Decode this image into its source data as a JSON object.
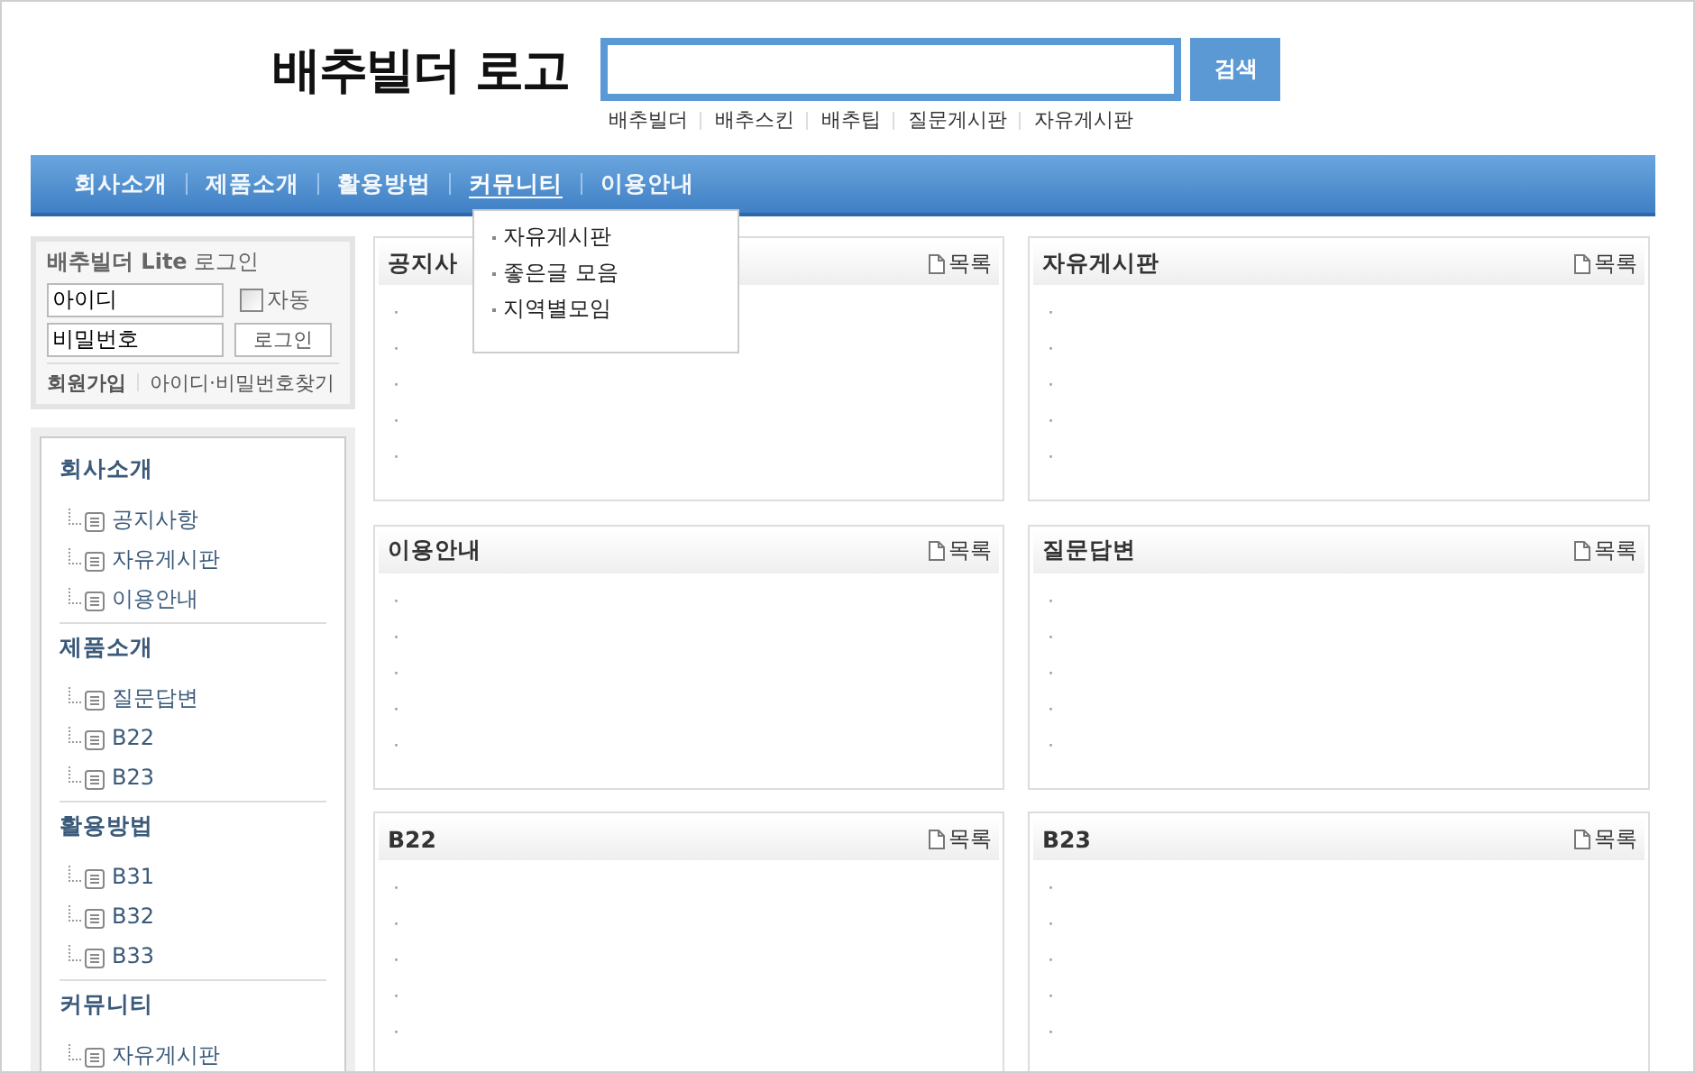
{
  "logo": "배추빌더 로고",
  "search": {
    "button": "검색"
  },
  "quick_links": [
    "배추빌더",
    "배추스킨",
    "배추팁",
    "질문게시판",
    "자유게시판"
  ],
  "nav": [
    {
      "label": "회사소개",
      "selected": false
    },
    {
      "label": "제품소개",
      "selected": false
    },
    {
      "label": "활용방법",
      "selected": false
    },
    {
      "label": "커뮤니티",
      "selected": true
    },
    {
      "label": "이용안내",
      "selected": false
    }
  ],
  "dropdown": [
    "자유게시판",
    "좋은글 모음",
    "지역별모임"
  ],
  "login": {
    "title_bold": "배추빌더 Lite",
    "title": "로그인",
    "id_value": "아이디",
    "pw_value": "비밀번호",
    "auto_label": "자동",
    "auto_checked": false,
    "button": "로그인",
    "join": "회원가입",
    "find": "아이디·비밀번호찾기"
  },
  "sidebar": [
    {
      "title": "회사소개",
      "items": [
        "공지사항",
        "자유게시판",
        "이용안내"
      ]
    },
    {
      "title": "제품소개",
      "items": [
        "질문답변",
        "B22",
        "B23"
      ]
    },
    {
      "title": "활용방법",
      "items": [
        "B31",
        "B32",
        "B33"
      ]
    },
    {
      "title": "커뮤니티",
      "items": [
        "자유게시판"
      ]
    }
  ],
  "boards": [
    {
      "title": "공지사",
      "more": "목록",
      "items": [
        "·",
        "·",
        "·",
        "·",
        "·"
      ]
    },
    {
      "title": "자유게시판",
      "more": "목록",
      "items": [
        "·",
        "·",
        "·",
        "·",
        "·"
      ]
    },
    {
      "title": "이용안내",
      "more": "목록",
      "items": [
        "·",
        "·",
        "·",
        "·",
        "·"
      ]
    },
    {
      "title": "질문답변",
      "more": "목록",
      "items": [
        "·",
        "·",
        "·",
        "·",
        "·"
      ]
    },
    {
      "title": "B22",
      "more": "목록",
      "items": [
        "·",
        "·",
        "·",
        "·",
        "·"
      ]
    },
    {
      "title": "B23",
      "more": "목록",
      "items": [
        "·",
        "·",
        "·",
        "·",
        "·"
      ]
    }
  ]
}
